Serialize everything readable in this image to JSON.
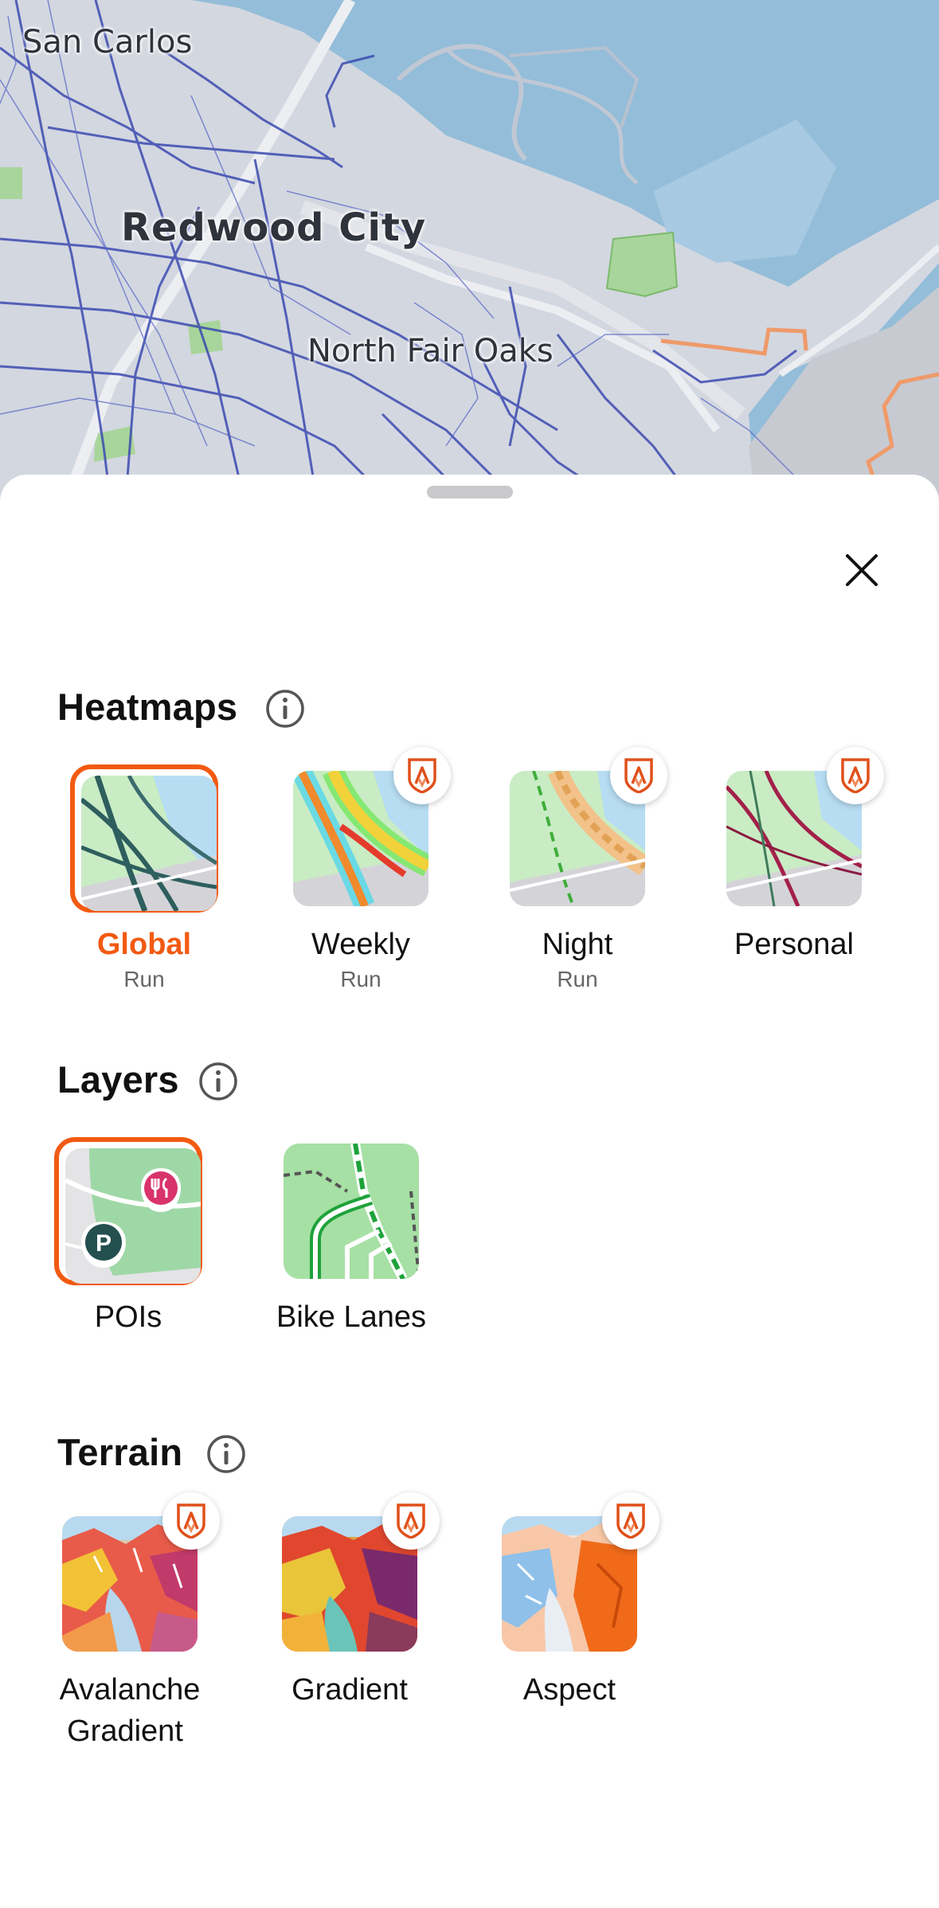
{
  "map": {
    "labels": {
      "san_carlos": "San Carlos",
      "redwood_city": "Redwood City",
      "north_fair_oaks": "North Fair Oaks"
    }
  },
  "sheet": {
    "close_icon": "close-icon",
    "heatmaps": {
      "title": "Heatmaps",
      "info_icon": "info-icon",
      "items": [
        {
          "label": "Global",
          "sub": "Run",
          "selected": true,
          "premium": false
        },
        {
          "label": "Weekly",
          "sub": "Run",
          "selected": false,
          "premium": true
        },
        {
          "label": "Night",
          "sub": "Run",
          "selected": false,
          "premium": true
        },
        {
          "label": "Personal",
          "sub": "",
          "selected": false,
          "premium": true
        }
      ]
    },
    "layers": {
      "title": "Layers",
      "info_icon": "info-icon",
      "items": [
        {
          "label": "POIs",
          "selected": true
        },
        {
          "label": "Bike Lanes",
          "selected": false
        }
      ]
    },
    "terrain": {
      "title": "Terrain",
      "info_icon": "info-icon",
      "items": [
        {
          "label_line1": "Avalanche",
          "label_line2": "Gradient",
          "premium": true
        },
        {
          "label": "Gradient",
          "premium": true
        },
        {
          "label": "Aspect",
          "premium": true
        }
      ]
    }
  },
  "colors": {
    "accent": "#f25a12",
    "water": "#93bdd9",
    "heatmap_line": "#3c4bb0",
    "route": "#ef9a6a"
  }
}
